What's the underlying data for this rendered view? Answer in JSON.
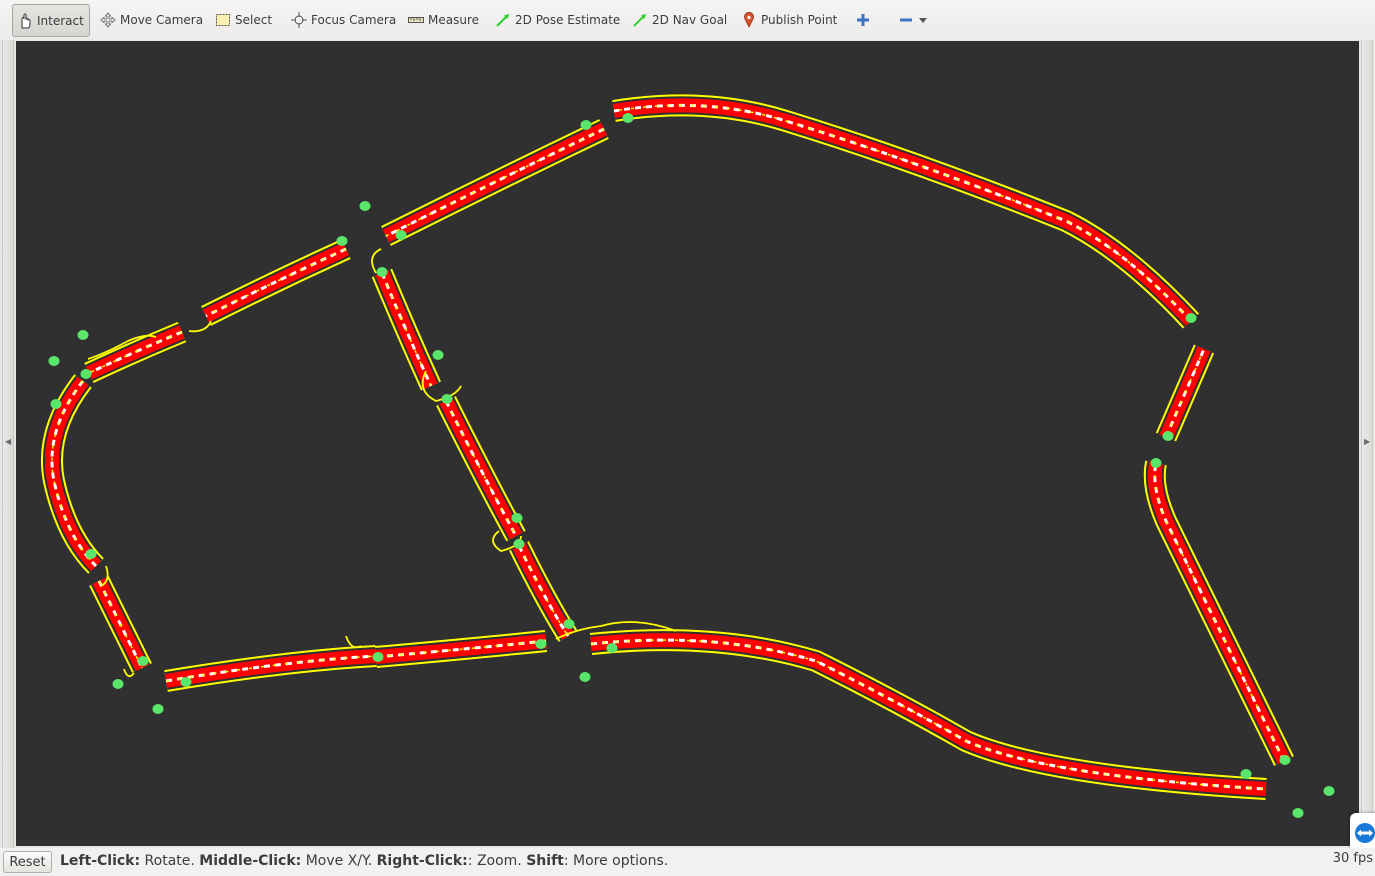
{
  "toolbar": {
    "tools": [
      {
        "label": "Interact",
        "icon": "hand-pointer-icon",
        "active": true
      },
      {
        "label": "Move Camera",
        "icon": "move-arrows-icon"
      },
      {
        "label": "Select",
        "icon": "select-rectangle-icon"
      },
      {
        "label": "Focus Camera",
        "icon": "focus-crosshair-icon"
      },
      {
        "label": "Measure",
        "icon": "ruler-icon"
      },
      {
        "label": "2D Pose Estimate",
        "icon": "green-arrow-icon"
      },
      {
        "label": "2D Nav Goal",
        "icon": "green-arrow-icon"
      },
      {
        "label": "Publish Point",
        "icon": "map-pin-icon"
      }
    ],
    "add_icon": "plus-icon",
    "remove_icon": "minus-icon"
  },
  "viewport": {
    "background": "#303030",
    "road_edge_color": "#ffff00",
    "road_fill_color": "#ff0000",
    "lane_mark_color": "#ffffff",
    "waypoint_color": "#5ae66a"
  },
  "status": {
    "reset_label": "Reset",
    "hint": [
      {
        "key": "Left-Click:",
        "text": " Rotate. "
      },
      {
        "key": "Middle-Click:",
        "text": " Move X/Y. "
      },
      {
        "key": "Right-Click:",
        "text": ": Zoom. "
      },
      {
        "key": "Shift",
        "text": ": More options."
      }
    ],
    "fps": "30 fps"
  }
}
